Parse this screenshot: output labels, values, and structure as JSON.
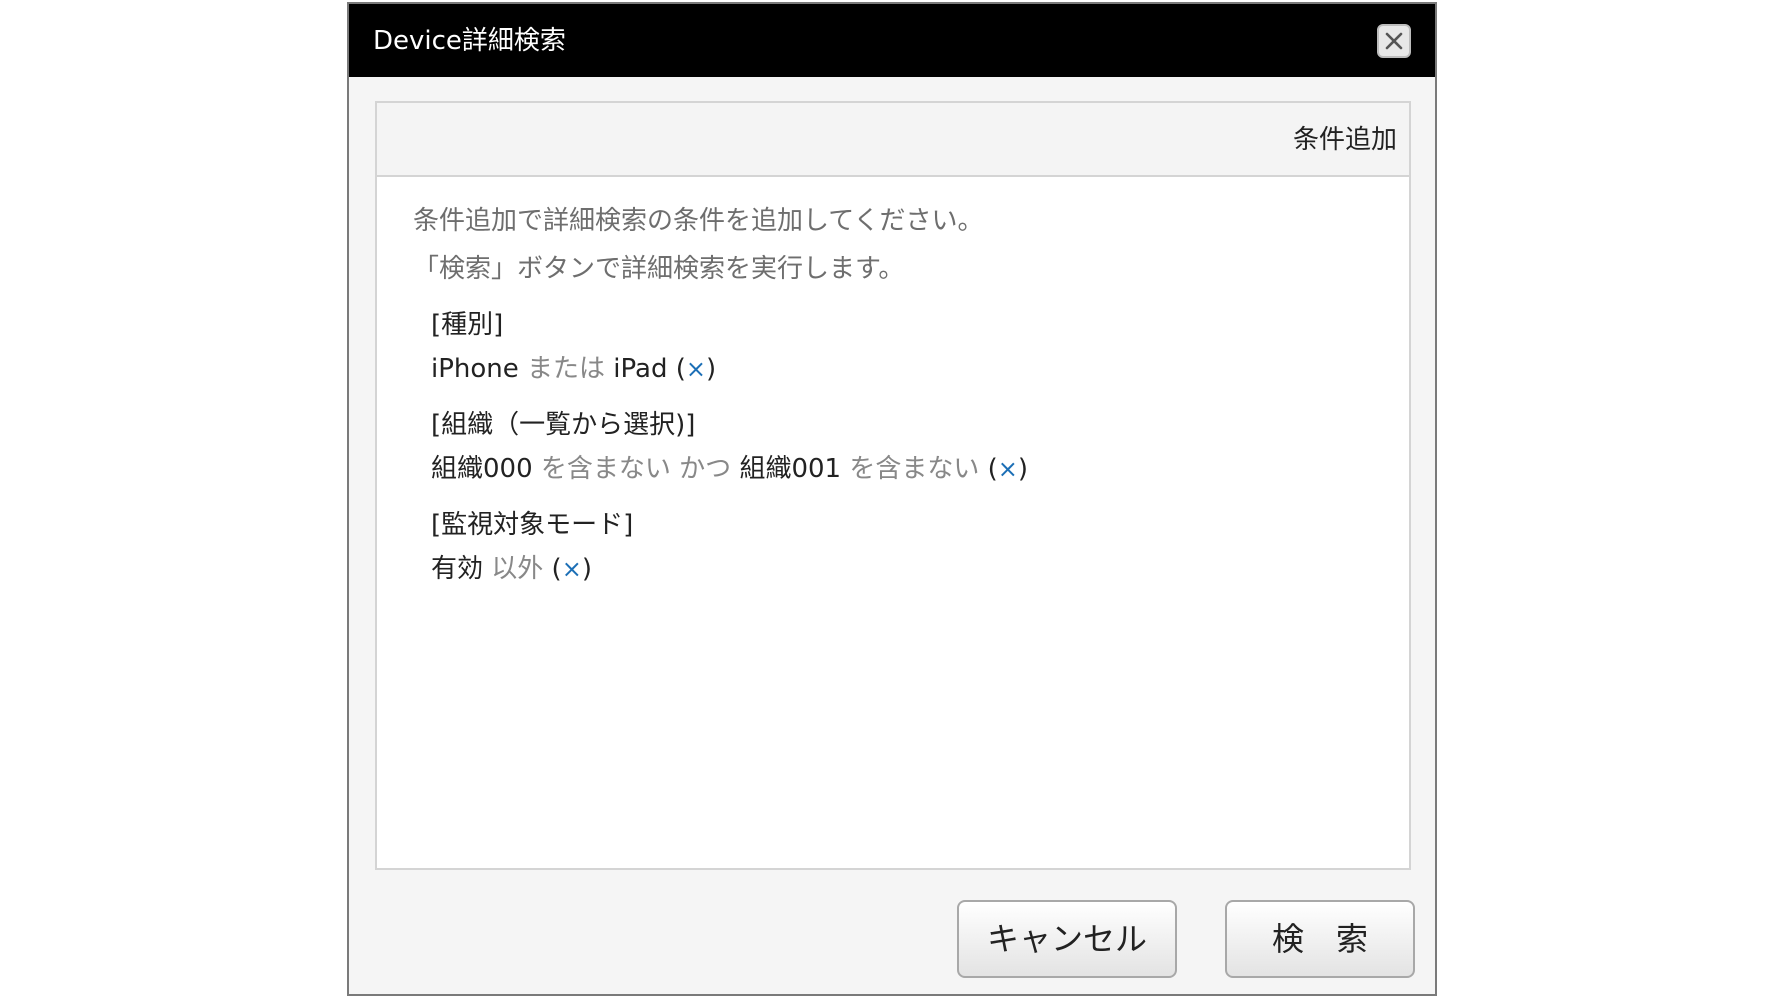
{
  "dialog": {
    "title": "Device詳細検索",
    "close_icon": "close-icon"
  },
  "panel": {
    "add_condition_label": "条件追加",
    "instructions": [
      "条件追加で詳細検索の条件を追加してください。",
      "「検索」ボタンで詳細検索を実行します。"
    ],
    "conditions": [
      {
        "label": "[種別]",
        "parts": [
          {
            "text": "iPhone",
            "kind": "value"
          },
          {
            "text": " または ",
            "kind": "keyword"
          },
          {
            "text": "iPad",
            "kind": "value"
          }
        ]
      },
      {
        "label": "[組織（一覧から選択)]",
        "parts": [
          {
            "text": "組織000",
            "kind": "value"
          },
          {
            "text": " を含まない かつ ",
            "kind": "keyword"
          },
          {
            "text": "組織001",
            "kind": "value"
          },
          {
            "text": " を含まない",
            "kind": "keyword"
          }
        ]
      },
      {
        "label": "[監視対象モード]",
        "parts": [
          {
            "text": "有効",
            "kind": "value"
          },
          {
            "text": " 以外",
            "kind": "keyword"
          }
        ]
      }
    ],
    "remove_symbol": "×",
    "paren_open": " (",
    "paren_close": ")"
  },
  "footer": {
    "cancel_label": "キャンセル",
    "search_label": "検　索"
  },
  "colors": {
    "titlebar": "#000000",
    "remove_link": "#1c6fb6",
    "keyword_text": "#888888"
  }
}
